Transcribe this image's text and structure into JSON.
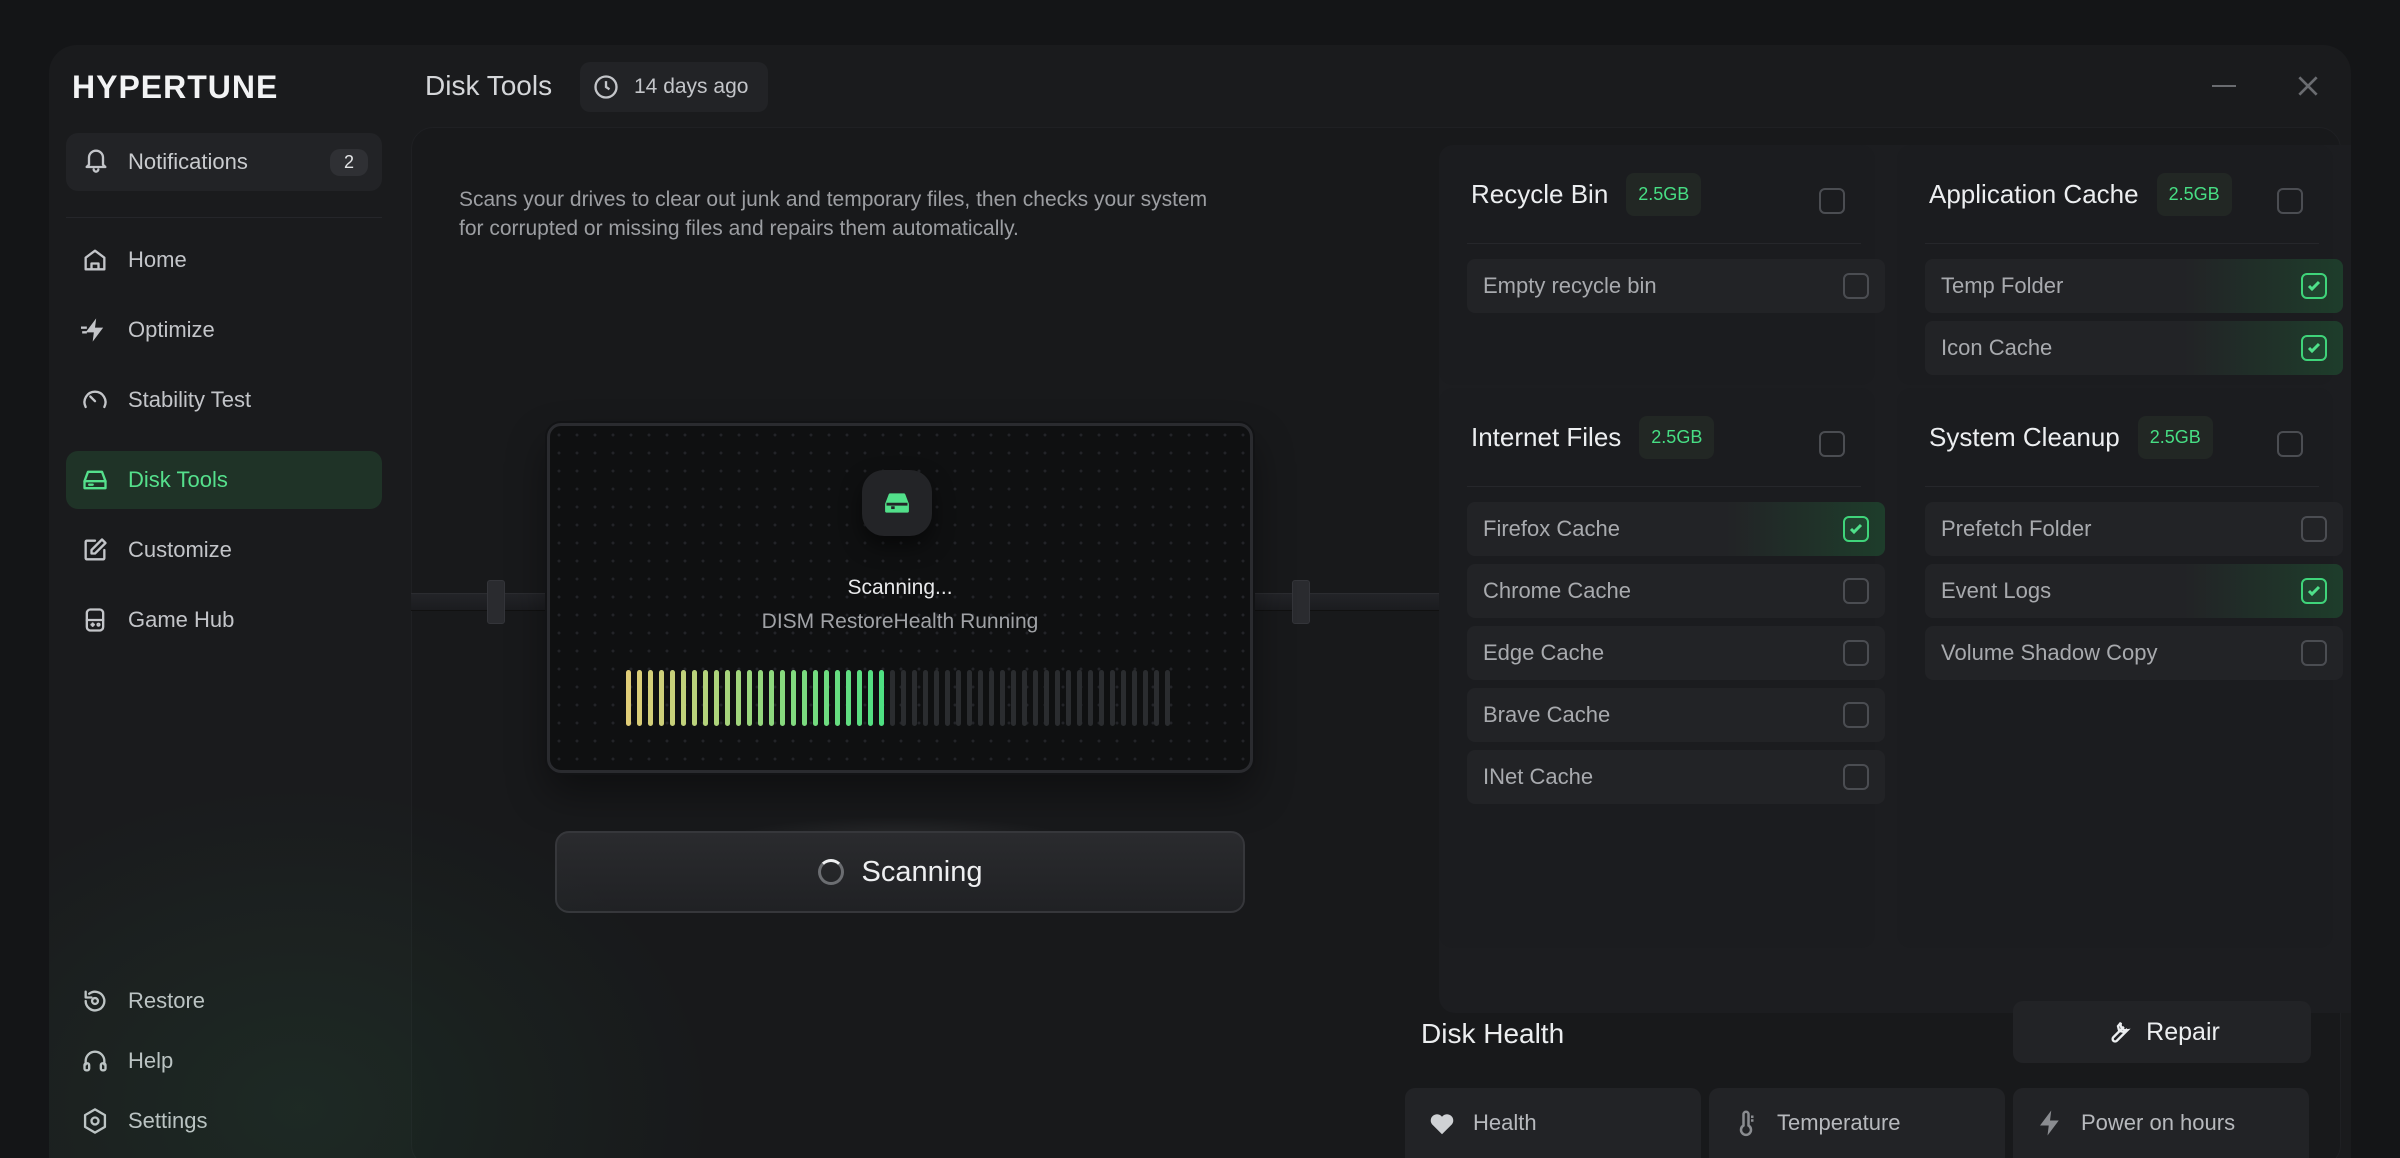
{
  "app": {
    "logo": "HYPERTUNE"
  },
  "header": {
    "page_title": "Disk Tools",
    "last_scan": "14 days ago"
  },
  "sidebar": {
    "notifications": {
      "label": "Notifications",
      "count": "2"
    },
    "nav": [
      {
        "label": "Home",
        "icon": "home-icon"
      },
      {
        "label": "Optimize",
        "icon": "bolt-icon"
      },
      {
        "label": "Stability Test",
        "icon": "gauge-icon"
      },
      {
        "label": "Disk Tools",
        "icon": "disk-icon",
        "active": true
      },
      {
        "label": "Customize",
        "icon": "edit-icon"
      },
      {
        "label": "Game Hub",
        "icon": "gamepad-icon"
      }
    ],
    "bottom": [
      {
        "label": "Restore",
        "icon": "restore-icon"
      },
      {
        "label": "Help",
        "icon": "headset-icon"
      },
      {
        "label": "Settings",
        "icon": "gear-icon"
      }
    ]
  },
  "main": {
    "description": "Scans your drives to clear out junk and temporary files, then checks your system for corrupted or missing files and repairs them automatically.",
    "scanner": {
      "status": "Scanning...",
      "task": "DISM RestoreHealth Running",
      "progress": 0.48
    },
    "scan_button": "Scanning"
  },
  "cleanup": {
    "recycle_bin": {
      "title": "Recycle Bin",
      "size": "2.5GB",
      "checked": false,
      "items": [
        {
          "label": "Empty recycle bin",
          "checked": false
        }
      ]
    },
    "application_cache": {
      "title": "Application Cache",
      "size": "2.5GB",
      "checked": false,
      "items": [
        {
          "label": "Temp Folder",
          "checked": true
        },
        {
          "label": "Icon Cache",
          "checked": true
        }
      ]
    },
    "internet_files": {
      "title": "Internet Files",
      "size": "2.5GB",
      "checked": false,
      "items": [
        {
          "label": "Firefox Cache",
          "checked": true
        },
        {
          "label": "Chrome Cache",
          "checked": false
        },
        {
          "label": "Edge Cache",
          "checked": false
        },
        {
          "label": "Brave Cache",
          "checked": false
        },
        {
          "label": "INet Cache",
          "checked": false
        }
      ]
    },
    "system_cleanup": {
      "title": "System Cleanup",
      "size": "2.5GB",
      "checked": false,
      "items": [
        {
          "label": "Prefetch Folder",
          "checked": false
        },
        {
          "label": "Event Logs",
          "checked": true
        },
        {
          "label": "Volume Shadow Copy",
          "checked": false
        }
      ]
    }
  },
  "disk_health": {
    "title": "Disk Health",
    "repair_label": "Repair",
    "metrics": [
      {
        "label": "Health",
        "icon": "heart-icon"
      },
      {
        "label": "Temperature",
        "icon": "thermometer-icon"
      },
      {
        "label": "Power on hours",
        "icon": "bolt-icon"
      }
    ]
  },
  "colors": {
    "accent": "#47de84",
    "background": "#141517",
    "panel": "#1a1b1d"
  }
}
